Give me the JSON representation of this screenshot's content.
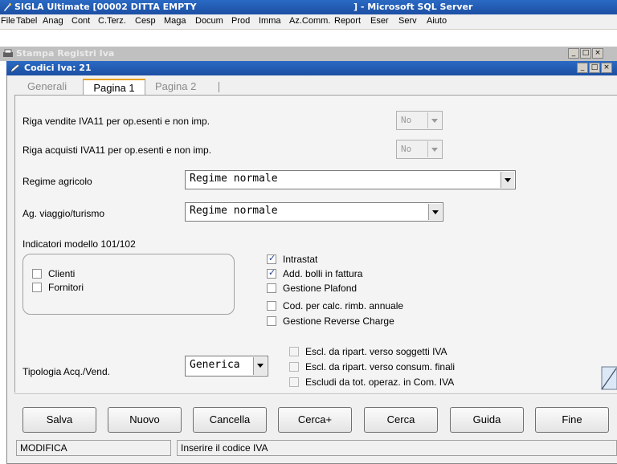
{
  "app": {
    "title": "SIGLA Ultimate [00002 DITTA EMPTY",
    "title_suffix": "] - Microsoft SQL Server"
  },
  "menu": [
    "File",
    "Tabel",
    "Anag",
    "Cont",
    "C.Terz.",
    "Cesp",
    "Maga",
    "Docum",
    "Prod",
    "Imma",
    "Az.Comm.",
    "Report",
    "Eser",
    "Serv",
    "Aiuto"
  ],
  "background_window": {
    "title": "Stampa Registri Iva"
  },
  "window": {
    "title": "Codici Iva: 21",
    "tabs": [
      {
        "label": "Generali",
        "active": false
      },
      {
        "label": "Pagina 1",
        "active": true
      },
      {
        "label": "Pagina 2",
        "active": false
      }
    ]
  },
  "form": {
    "riga_vendite": {
      "label": "Riga vendite IVA11 per op.esenti e non imp.",
      "value": "No"
    },
    "riga_acquisti": {
      "label": "Riga acquisti IVA11 per op.esenti e non imp.",
      "value": "No"
    },
    "regime_agricolo": {
      "label": "Regime agricolo",
      "value": "Regime normale"
    },
    "ag_viaggio": {
      "label": "Ag. viaggio/turismo",
      "value": "Regime normale"
    },
    "indicatori": {
      "label": "Indicatori modello 101/102",
      "clienti": {
        "label": "Clienti",
        "checked": false
      },
      "fornitori": {
        "label": "Fornitori",
        "checked": false
      }
    },
    "options": [
      {
        "label": "Intrastat",
        "checked": true
      },
      {
        "label": "Add. bolli in fattura",
        "checked": true
      },
      {
        "label": "Gestione Plafond",
        "checked": false
      },
      {
        "label": "Cod. per calc. rimb. annuale",
        "checked": false
      },
      {
        "label": "Gestione Reverse Charge",
        "checked": false
      }
    ],
    "tipologia": {
      "label": "Tipologia Acq./Vend.",
      "value": "Generica"
    },
    "escl": [
      {
        "label": "Escl. da ripart. verso soggetti IVA",
        "checked": false
      },
      {
        "label": "Escl. da ripart. verso consum. finali",
        "checked": false
      },
      {
        "label": "Escludi da tot. operaz. in Com. IVA",
        "checked": false
      }
    ]
  },
  "buttons": {
    "salva": "Salva",
    "nuovo": "Nuovo",
    "cancella": "Cancella",
    "cerca_plus": "Cerca+",
    "cerca": "Cerca",
    "guida": "Guida",
    "fine": "Fine"
  },
  "status": {
    "mode": "MODIFICA",
    "message": "Inserire il codice IVA"
  },
  "colors": {
    "titlebar": "#1c4fa3",
    "tab_accent": "#e5a020"
  }
}
